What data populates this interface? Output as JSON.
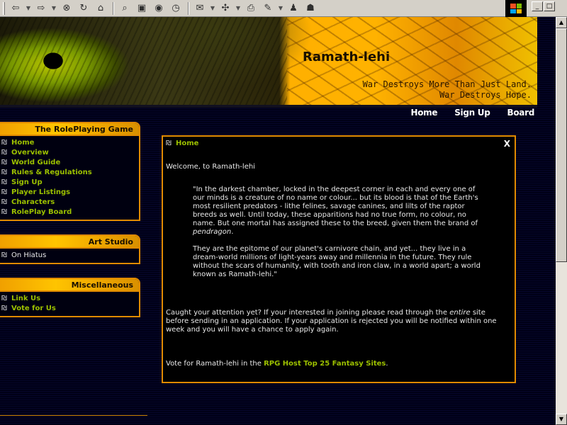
{
  "browser": {
    "toolbar_icons": [
      "back-icon",
      "forward-icon",
      "stop-icon",
      "refresh-icon",
      "home-icon",
      "search-icon",
      "favorites-icon",
      "media-icon",
      "history-icon",
      "mail-icon",
      "print-icon",
      "edit-icon",
      "messenger-icon"
    ]
  },
  "banner": {
    "title": "Ramath-lehi",
    "tagline_line1": "War Destroys More Than Just Land.",
    "tagline_line2": "War Destroys Hope."
  },
  "topnav": [
    "Home",
    "Sign Up",
    "Board"
  ],
  "sidebar": {
    "roleplaying": {
      "heading": "The RolePlaying Game",
      "items": [
        "Home",
        "Overview",
        "World Guide",
        "Rules & Regulations",
        "Sign Up",
        "Player Listings",
        "Characters",
        "RolePlay Board"
      ]
    },
    "art_studio": {
      "heading": "Art Studio",
      "status": "On Hiatus"
    },
    "misc": {
      "heading": "Miscellaneous",
      "items": [
        "Link Us",
        "Vote for Us"
      ]
    }
  },
  "content": {
    "heading": "Home",
    "close_label": "X",
    "welcome": "Welcome, to Ramath-lehi",
    "quote_p1_a": "\"In the darkest chamber, locked in the deepest corner in each and every one of our minds is a creature of no name or colour... but its blood is that of the Earth's most resilient predators - lithe felines, savage canines, and lilts of the raptor breeds as well. Until today, these apparitions had no true form, no colour, no name. But one mortal has assigned these to the breed, given them the brand of ",
    "quote_p1_em": "pendragon",
    "quote_p1_b": ".",
    "quote_p2": "They are the epitome of our planet's carnivore chain, and yet... they live in a dream-world millions of light-years away and millennia in the future. They rule without the scars of humanity, with tooth and iron claw, in a world apart; a world known as Ramath-lehi.\"",
    "attention_a": "Caught your attention yet? If your interested in joining please read through the ",
    "attention_em": "entire",
    "attention_b": " site before sending in an application. If your application is rejected you will be notified within one week and you will have a chance to apply again.",
    "vote_a": "Vote for Ramath-lehi in the ",
    "vote_link": "RPG Host Top 25 Fantasy Sites",
    "vote_b": "."
  },
  "colors": {
    "accent_orange": "#e08a00",
    "link_green": "#9cc000",
    "background": "#000010"
  }
}
